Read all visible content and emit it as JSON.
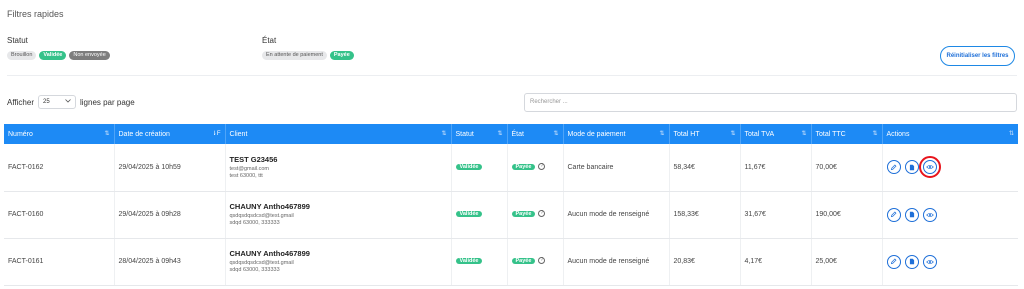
{
  "quick_filters": {
    "title": "Filtres rapides"
  },
  "statut": {
    "label": "Statut",
    "chips": [
      "Brouillon",
      "Validée",
      "Non envoyée"
    ]
  },
  "etat": {
    "label": "État",
    "chips": [
      "En attente de paiement",
      "Payée"
    ]
  },
  "reset_label": "Réinitialiser les filtres",
  "page_size": {
    "prefix": "Afficher",
    "value": "25",
    "suffix": "lignes par page"
  },
  "search": {
    "placeholder": "Rechercher ..."
  },
  "columns": [
    "Numéro",
    "Date de création",
    "Client",
    "Statut",
    "État",
    "Mode de paiement",
    "Total HT",
    "Total TVA",
    "Total TTC",
    "Actions"
  ],
  "rows": [
    {
      "numero": "FACT-0162",
      "date": "29/04/2025 à 10h59",
      "client_name": "TEST G23456",
      "client_email": "test@gmail.com",
      "client_addr": "test 63000, ttt",
      "statut": "Validée",
      "etat": "Payée",
      "mode": "Carte bancaire",
      "ht": "58,34€",
      "tva": "11,67€",
      "ttc": "70,00€"
    },
    {
      "numero": "FACT-0160",
      "date": "29/04/2025 à 09h28",
      "client_name": "CHAUNY Antho467899",
      "client_email": "qsdqsdqsdcsd@test.gmail",
      "client_addr": "sdqd 63000, 333333",
      "statut": "Validée",
      "etat": "Payée",
      "mode": "Aucun mode de renseigné",
      "ht": "158,33€",
      "tva": "31,67€",
      "ttc": "190,00€"
    },
    {
      "numero": "FACT-0161",
      "date": "28/04/2025 à 09h43",
      "client_name": "CHAUNY Antho467899",
      "client_email": "qsdqsdqsdcsd@test.gmail",
      "client_addr": "sdqd 63000, 333333",
      "statut": "Validée",
      "etat": "Payée",
      "mode": "Aucun mode de renseigné",
      "ht": "20,83€",
      "tva": "4,17€",
      "ttc": "25,00€"
    }
  ],
  "icons": {
    "edit": "pencil-icon",
    "file": "document-icon",
    "view": "eye-icon",
    "info": "info-circle-icon"
  },
  "colors": {
    "accent": "#1d8af5",
    "success": "#35c28a",
    "highlight": "#e8141c"
  }
}
